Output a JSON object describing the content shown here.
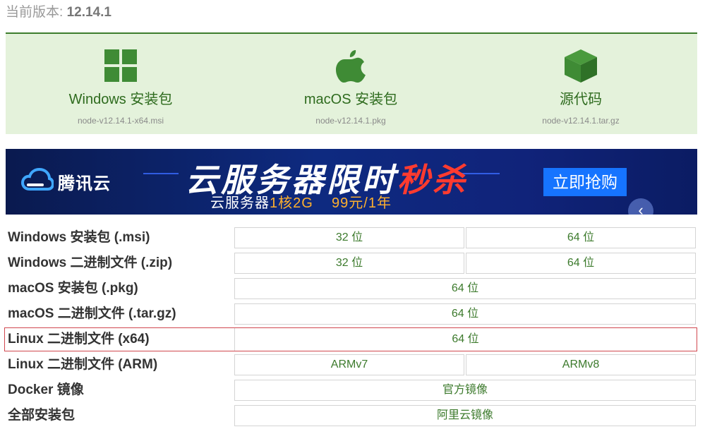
{
  "version": {
    "label": "当前版本:",
    "number": "12.14.1"
  },
  "downloads": [
    {
      "title": "Windows 安装包",
      "file": "node-v12.14.1-x64.msi",
      "icon": "windows-icon"
    },
    {
      "title": "macOS 安装包",
      "file": "node-v12.14.1.pkg",
      "icon": "apple-icon"
    },
    {
      "title": "源代码",
      "file": "node-v12.14.1.tar.gz",
      "icon": "cube-icon"
    }
  ],
  "banner": {
    "brand": "腾讯云",
    "headline_main": "云服务器限时",
    "headline_hot": "秒杀",
    "sub_prefix": "云服务器",
    "sub_spec": "1核2G",
    "sub_price": "99元/1年",
    "button": "立即抢购"
  },
  "table": [
    {
      "label": "Windows 安装包 (.msi)",
      "cells": [
        "32 位",
        "64 位"
      ]
    },
    {
      "label": "Windows 二进制文件 (.zip)",
      "cells": [
        "32 位",
        "64 位"
      ]
    },
    {
      "label": "macOS 安装包 (.pkg)",
      "cells": [
        "64 位"
      ]
    },
    {
      "label": "macOS 二进制文件 (.tar.gz)",
      "cells": [
        "64 位"
      ]
    },
    {
      "label": "Linux 二进制文件 (x64)",
      "cells": [
        "64 位"
      ]
    },
    {
      "label": "Linux 二进制文件 (ARM)",
      "cells": [
        "ARMv7",
        "ARMv8"
      ]
    },
    {
      "label": "Docker 镜像",
      "cells": [
        "官方镜像"
      ]
    },
    {
      "label": "全部安装包",
      "cells": [
        "阿里云镜像"
      ]
    }
  ],
  "colors": {
    "accent_green": "#3d7d2d",
    "highlight_border": "#d1474f",
    "banner_button": "#1674ff"
  }
}
